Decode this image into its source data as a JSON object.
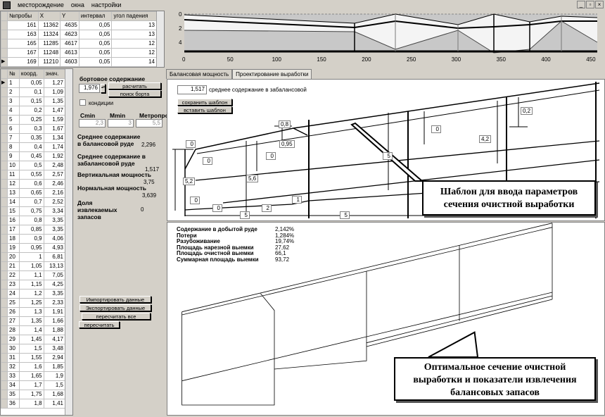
{
  "menu": {
    "items": [
      "месторождение",
      "окна",
      "настройки"
    ],
    "min": "_",
    "restore": "▫",
    "close": "×"
  },
  "samples": {
    "columns": [
      "№пробы",
      "X",
      "Y",
      "интервал",
      "угол падения"
    ],
    "rows": [
      [
        "161",
        "11362",
        "4635",
        "0,05",
        "13"
      ],
      [
        "163",
        "11324",
        "4623",
        "0,05",
        "13"
      ],
      [
        "165",
        "11285",
        "4617",
        "0,05",
        "12"
      ],
      [
        "167",
        "11248",
        "4613",
        "0,05",
        "12"
      ],
      [
        "169",
        "11210",
        "4603",
        "0,05",
        "14"
      ]
    ]
  },
  "profile": {
    "columns": [
      "№",
      "коорд.",
      "знач."
    ],
    "rows": [
      [
        "1",
        "0,05",
        "1,27"
      ],
      [
        "2",
        "0,1",
        "1,09"
      ],
      [
        "3",
        "0,15",
        "1,35"
      ],
      [
        "4",
        "0,2",
        "1,47"
      ],
      [
        "5",
        "0,25",
        "1,59"
      ],
      [
        "6",
        "0,3",
        "1,67"
      ],
      [
        "7",
        "0,35",
        "1,34"
      ],
      [
        "8",
        "0,4",
        "1,74"
      ],
      [
        "9",
        "0,45",
        "1,92"
      ],
      [
        "10",
        "0,5",
        "2,48"
      ],
      [
        "11",
        "0,55",
        "2,57"
      ],
      [
        "12",
        "0,6",
        "2,46"
      ],
      [
        "13",
        "0,65",
        "2,16"
      ],
      [
        "14",
        "0,7",
        "2,52"
      ],
      [
        "15",
        "0,75",
        "3,34"
      ],
      [
        "16",
        "0,8",
        "3,35"
      ],
      [
        "17",
        "0,85",
        "3,35"
      ],
      [
        "18",
        "0,9",
        "4,06"
      ],
      [
        "19",
        "0,95",
        "4,93"
      ],
      [
        "20",
        "1",
        "6,81"
      ],
      [
        "21",
        "1,05",
        "13,13"
      ],
      [
        "22",
        "1,1",
        "7,05"
      ],
      [
        "23",
        "1,15",
        "4,25"
      ],
      [
        "24",
        "1,2",
        "3,35"
      ],
      [
        "25",
        "1,25",
        "2,33"
      ],
      [
        "26",
        "1,3",
        "1,91"
      ],
      [
        "27",
        "1,35",
        "1,66"
      ],
      [
        "28",
        "1,4",
        "1,88"
      ],
      [
        "29",
        "1,45",
        "4,17"
      ],
      [
        "30",
        "1,5",
        "3,48"
      ],
      [
        "31",
        "1,55",
        "2,94"
      ],
      [
        "32",
        "1,6",
        "1,85"
      ],
      [
        "33",
        "1,65",
        "1,9"
      ],
      [
        "34",
        "1,7",
        "1,5"
      ],
      [
        "35",
        "1,75",
        "1,68"
      ],
      [
        "36",
        "1,8",
        "1,41"
      ]
    ]
  },
  "panel": {
    "cutoff_title": "бортовое содержание",
    "cutoff_value": "1,976",
    "calc_btn": "расчитать",
    "search_btn": "поиск борта",
    "conditions": "кондиции",
    "cmin_label": "Cmin",
    "mmin_label": "Mmin",
    "metro_label": "Метропроц",
    "cmin": "2,3",
    "mmin": "3",
    "metro": "5,5",
    "avg_bal_label": "Среднее содержание в балансовой руде",
    "avg_bal": "2,296",
    "avg_offbal_label": "Среднее содержание в забалансовой руде",
    "avg_offbal": "1,517",
    "vert_label": "Вертикальная мощность",
    "vert": "3,75",
    "norm_label": "Нормальная мощность",
    "norm": "3,639",
    "share_label": "Доля извлекаемых запасов",
    "share": "0",
    "import_btn": "Импортировать данные",
    "export_btn": "Экспортировать данные",
    "recalc_all_btn": "пересчитать все",
    "recalc_btn": "пересчитать"
  },
  "chart": {
    "y_ticks": [
      "0",
      "2",
      "4"
    ],
    "x_ticks": [
      "0",
      "50",
      "100",
      "150",
      "200",
      "250",
      "300",
      "350",
      "400",
      "450"
    ]
  },
  "tabs": [
    "Балансовая мощность",
    "Проектирование выработки"
  ],
  "design": {
    "offbal_value": "1,517",
    "offbal_label": "среднее содержание в забалансовой",
    "save_btn": "сохранить шаблон",
    "paste_btn": "вставить шаблон",
    "labels": [
      "0,8",
      "0,95",
      "0",
      "0",
      "0",
      "5,2",
      "5,6",
      "0",
      "0",
      "5",
      "2",
      "1",
      "5",
      "5",
      "0",
      "4,2",
      "0,2"
    ],
    "callout": [
      "Шаблон для ввода параметров",
      "сечения очистной выработки"
    ]
  },
  "result": {
    "stats": [
      [
        "Содержание в добытой руде",
        "2,142%"
      ],
      [
        "Потери",
        "1,284%"
      ],
      [
        "Разубоживание",
        "19,74%"
      ],
      [
        "Площадь нарезной выемки",
        "27,62"
      ],
      [
        "Площадь очистной выемки",
        "66,1"
      ],
      [
        "Суммарная площадь выемки",
        "93,72"
      ]
    ],
    "callout": [
      "Оптимальное сечение очистной",
      "выработки и показатели извлечения",
      "балансовых запасов"
    ]
  }
}
